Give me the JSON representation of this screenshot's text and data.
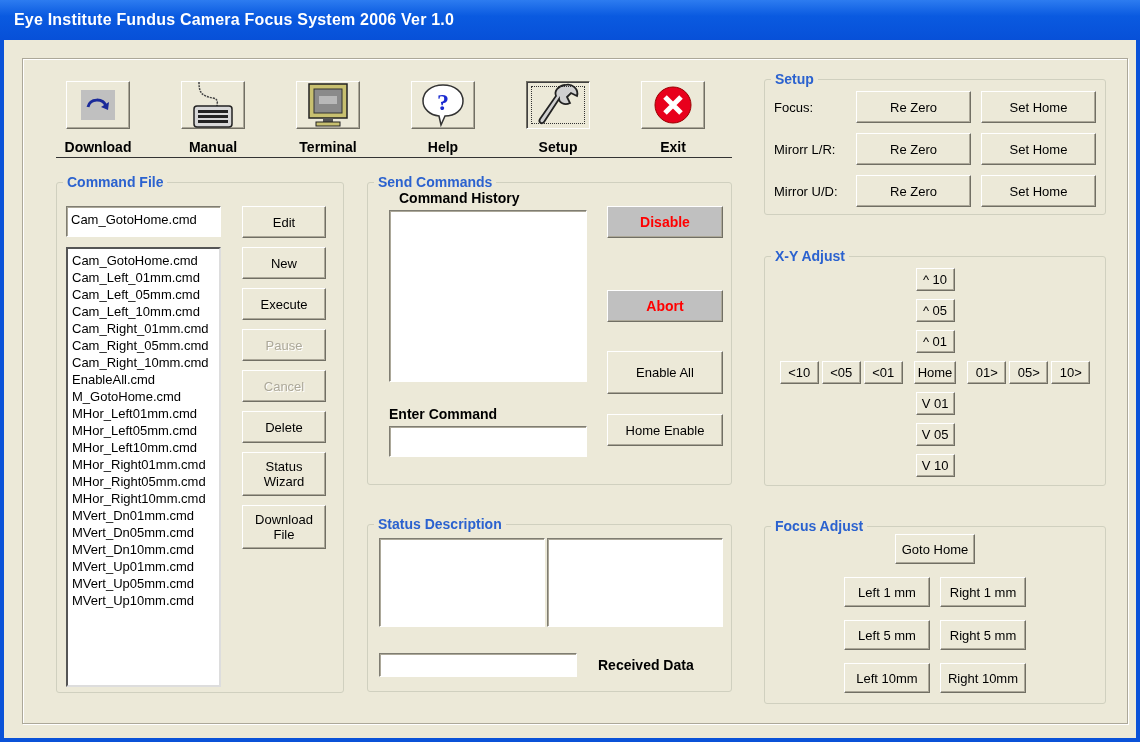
{
  "window": {
    "title": "Eye Institute Fundus Camera Focus System 2006 Ver 1.0"
  },
  "toolbar": [
    {
      "label": "Download",
      "kind": "download",
      "selected": false
    },
    {
      "label": "Manual",
      "kind": "keyboard",
      "selected": false
    },
    {
      "label": "Terminal",
      "kind": "monitor",
      "selected": false
    },
    {
      "label": "Help",
      "kind": "help",
      "selected": false,
      "icon_text": "?"
    },
    {
      "label": "Setup",
      "kind": "wrench",
      "selected": true
    },
    {
      "label": "Exit",
      "kind": "exit",
      "selected": false
    }
  ],
  "command_file": {
    "title": "Command File",
    "filename": "Cam_GotoHome.cmd",
    "files": [
      "Cam_GotoHome.cmd",
      "Cam_Left_01mm.cmd",
      "Cam_Left_05mm.cmd",
      "Cam_Left_10mm.cmd",
      "Cam_Right_01mm.cmd",
      "Cam_Right_05mm.cmd",
      "Cam_Right_10mm.cmd",
      "EnableAll.cmd",
      "M_GotoHome.cmd",
      "MHor_Left01mm.cmd",
      "MHor_Left05mm.cmd",
      "MHor_Left10mm.cmd",
      "MHor_Right01mm.cmd",
      "MHor_Right05mm.cmd",
      "MHor_Right10mm.cmd",
      "MVert_Dn01mm.cmd",
      "MVert_Dn05mm.cmd",
      "MVert_Dn10mm.cmd",
      "MVert_Up01mm.cmd",
      "MVert_Up05mm.cmd",
      "MVert_Up10mm.cmd"
    ],
    "buttons": [
      {
        "label": "Edit",
        "disabled": false
      },
      {
        "label": "New",
        "disabled": false
      },
      {
        "label": "Execute",
        "disabled": false
      },
      {
        "label": "Pause",
        "disabled": true
      },
      {
        "label": "Cancel",
        "disabled": true
      },
      {
        "label": "Delete",
        "disabled": false
      },
      {
        "label": "Status Wizard",
        "disabled": false
      },
      {
        "label": "Download File",
        "disabled": false
      }
    ]
  },
  "send_commands": {
    "title": "Send Commands",
    "history_label": "Command History",
    "enter_label": "Enter Command",
    "buttons": [
      {
        "label": "Disable",
        "kind": "alert"
      },
      {
        "label": "Abort",
        "kind": "alert"
      },
      {
        "label": "Enable All",
        "kind": "normal"
      },
      {
        "label": "Home Enable",
        "kind": "normal"
      }
    ]
  },
  "status_description": {
    "title": "Status Description",
    "received_label": "Received Data"
  },
  "setup": {
    "title": "Setup",
    "rows": [
      {
        "label": "Focus:",
        "buttons": [
          "Re Zero",
          "Set Home"
        ]
      },
      {
        "label": "Mirorr L/R:",
        "buttons": [
          "Re Zero",
          "Set Home"
        ]
      },
      {
        "label": "Mirror U/D:",
        "buttons": [
          "Re Zero",
          "Set Home"
        ]
      }
    ]
  },
  "xy_adjust": {
    "title": "X-Y Adjust",
    "up": [
      "^ 10",
      "^ 05",
      "^ 01"
    ],
    "row": [
      "<10",
      "<05",
      "<01",
      "Home",
      "01>",
      "05>",
      "10>"
    ],
    "down": [
      "V 01",
      "V 05",
      "V 10"
    ]
  },
  "focus_adjust": {
    "title": "Focus Adjust",
    "home": "Goto Home",
    "rows": [
      [
        "Left 1 mm",
        "Right 1 mm"
      ],
      [
        "Left 5 mm",
        "Right 5 mm"
      ],
      [
        "Left 10mm",
        "Right 10mm"
      ]
    ]
  }
}
